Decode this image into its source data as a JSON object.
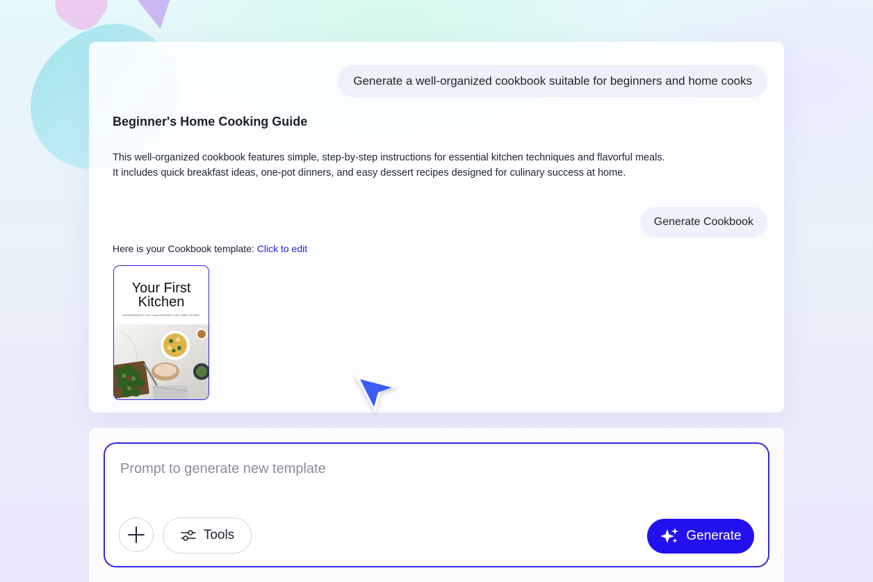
{
  "chat": {
    "user_prompt": "Generate a well-organized cookbook suitable for beginners and home cooks",
    "response_title": "Beginner's Home Cooking Guide",
    "response_paragraph": [
      "This well-organized cookbook features simple, step-by-step instructions for essential kitchen techniques and flavorful meals.",
      "It includes quick breakfast ideas, one-pot dinners, and easy dessert recipes designed for culinary success at home."
    ],
    "generate_cookbook_label": "Generate Cookbook",
    "template_intro": "Here is your Cookbook template:",
    "template_link": "Click to edit",
    "template_thumbnail": {
      "title_line1": "Your First",
      "title_line2": "Kitchen",
      "contact_line": "hello@firstkitchen.com | www.firstkitchen.com | (555) 123-4567"
    }
  },
  "prompt": {
    "placeholder": "Prompt to generate new template",
    "value": "",
    "add_icon": "plus-icon",
    "tools_icon": "sliders-icon",
    "tools_label": "Tools",
    "generate_icon": "sparkles-icon",
    "generate_label": "Generate"
  },
  "colors": {
    "accent": "#2211ee",
    "link": "#2420e0",
    "bubble_bg": "#eef0fb",
    "cursor": "#3d5cf5"
  }
}
